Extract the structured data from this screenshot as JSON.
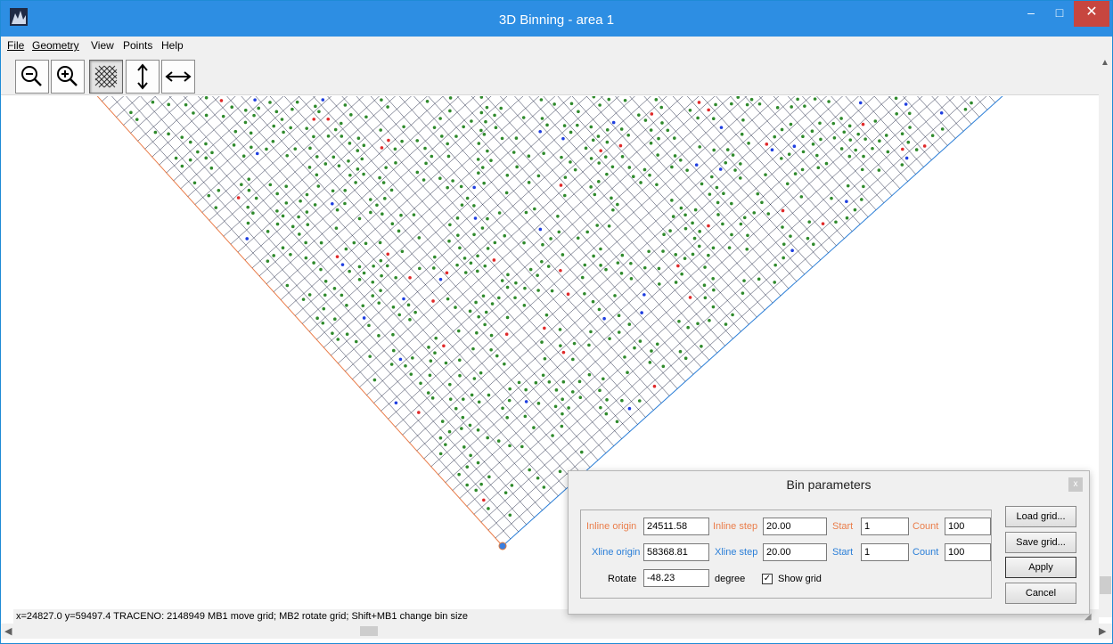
{
  "window": {
    "title": "3D Binning - area 1"
  },
  "window_controls": {
    "minimize": "–",
    "maximize": "□",
    "close": "✕"
  },
  "menu": {
    "file": "File",
    "geometry": "Geometry",
    "view": "View",
    "points": "Points",
    "help": "Help"
  },
  "toolbar": {
    "buttons": [
      {
        "icon": "zoom-out-icon",
        "active": false
      },
      {
        "icon": "zoom-in-icon",
        "active": false
      },
      {
        "icon": "grid-icon",
        "active": true
      },
      {
        "icon": "vertical-arrow-icon",
        "active": false
      },
      {
        "icon": "horizontal-arrow-icon",
        "active": false
      }
    ]
  },
  "canvas": {
    "colors": {
      "inline": "#ea7d4a",
      "xline": "#2b7fd8",
      "grid": "#1c2340",
      "point_green": "#2f8a2c",
      "point_blue": "#1f3fe0",
      "point_red": "#e02a2a",
      "origin": "#3a7fe0"
    }
  },
  "status": {
    "text": "x=24827.0 y=59497.4 TRACENO: 2148949   MB1 move grid; MB2 rotate grid; Shift+MB1 change bin size"
  },
  "dialog": {
    "title": "Bin parameters",
    "close": "x",
    "inline_origin_label": "Inline origin",
    "inline_origin": "24511.58",
    "inline_step_label": "Inline step",
    "inline_step": "20.00",
    "inline_start_label": "Start",
    "inline_start": "1",
    "inline_count_label": "Count",
    "inline_count": "100",
    "xline_origin_label": "Xline origin",
    "xline_origin": "58368.81",
    "xline_step_label": "Xline step",
    "xline_step": "20.00",
    "xline_start_label": "Start",
    "xline_start": "1",
    "xline_count_label": "Count",
    "xline_count": "100",
    "rotate_label": "Rotate",
    "rotate": "-48.23",
    "degree_label": "degree",
    "show_grid_label": "Show grid",
    "show_grid": true,
    "load_grid": "Load grid...",
    "save_grid": "Save grid...",
    "apply": "Apply",
    "cancel": "Cancel"
  }
}
